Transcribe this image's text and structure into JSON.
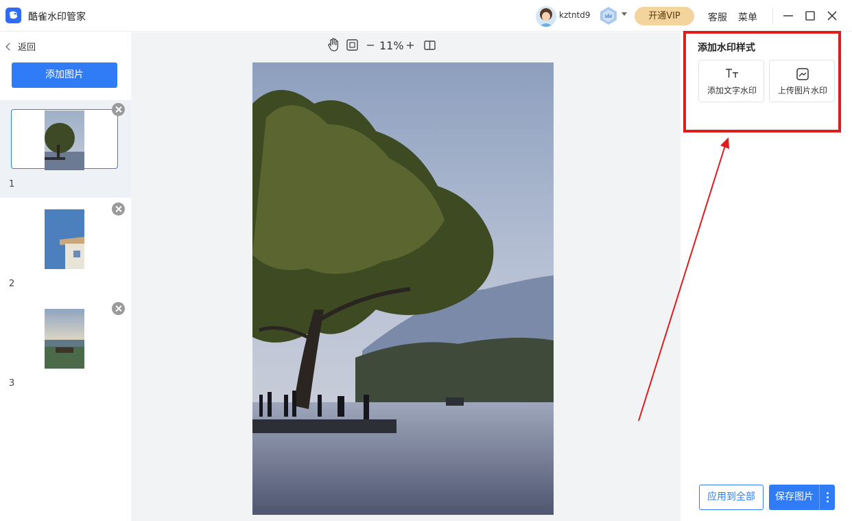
{
  "app": {
    "title": "酷雀水印管家"
  },
  "titlebar": {
    "username": "kztntd9",
    "vip_label": "开通VIP",
    "service_label": "客服",
    "menu_label": "菜单",
    "icons": [
      "avatar",
      "crown-icon",
      "minimize-icon",
      "maximize-icon",
      "close-icon"
    ]
  },
  "sidebar": {
    "back_label": "返回",
    "add_image_label": "添加图片",
    "thumbnails": [
      {
        "number": "1",
        "active": true
      },
      {
        "number": "2",
        "active": false
      },
      {
        "number": "3",
        "active": false
      }
    ]
  },
  "canvas": {
    "zoom": "11%",
    "tools": [
      "hand-tool-icon",
      "fit-screen-icon",
      "zoom-out-icon",
      "zoom-in-icon",
      "compare-icon"
    ]
  },
  "right_panel": {
    "title": "添加水印样式",
    "text_watermark_label": "添加文字水印",
    "image_watermark_label": "上传图片水印",
    "apply_all_label": "应用到全部",
    "save_label": "保存图片"
  },
  "colors": {
    "accent": "#2f7cf6",
    "vip": "#f3d49c",
    "annotation": "#e01b1b"
  }
}
